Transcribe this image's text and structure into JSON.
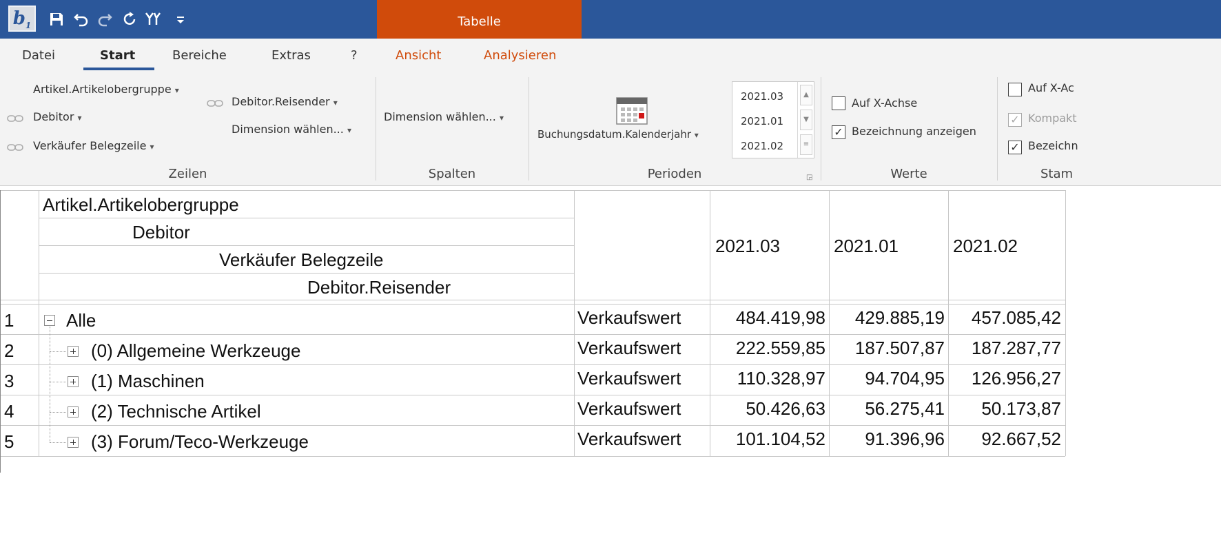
{
  "titlebar": {
    "logo_letter": "b",
    "logo_sub": "1",
    "context_tab": "Tabelle",
    "qa_icons": [
      "save-icon",
      "undo-icon",
      "redo-icon",
      "refresh-icon",
      "tools-icon",
      "customize-icon"
    ]
  },
  "tabs": {
    "datei": "Datei",
    "start": "Start",
    "bereiche": "Bereiche",
    "extras": "Extras",
    "help": "?",
    "ansicht": "Ansicht",
    "analysieren": "Analysieren"
  },
  "ribbon": {
    "zeilen": {
      "label": "Zeilen",
      "artikelobergruppe": "Artikel.Artikelobergruppe",
      "debitor": "Debitor",
      "verkaeufer": "Verkäufer Belegzeile",
      "reisender": "Debitor.Reisender",
      "dimension": "Dimension wählen..."
    },
    "spalten": {
      "label": "Spalten",
      "dimension": "Dimension wählen..."
    },
    "perioden": {
      "label": "Perioden",
      "field": "Buchungsdatum.Kalenderjahr",
      "values": [
        "2021.03",
        "2021.01",
        "2021.02"
      ]
    },
    "werte": {
      "label": "Werte",
      "x_achse": "Auf X-Achse",
      "bezeichnung": "Bezeichnung anzeigen"
    },
    "stamm": {
      "label": "Stam",
      "x_achse": "Auf X-Ac",
      "kompakt": "Kompakt",
      "bezeichnung": "Bezeichn"
    },
    "caret": "▾"
  },
  "grid": {
    "header_levels": [
      "Artikel.Artikelobergruppe",
      "Debitor",
      "Verkäufer Belegzeile",
      "Debitor.Reisender"
    ],
    "columns": [
      "2021.03",
      "2021.01",
      "2021.02"
    ],
    "rows": [
      {
        "num": "1",
        "label": "Alle",
        "measure": "Verkaufswert",
        "values": [
          "484.419,98",
          "429.885,19",
          "457.085,42"
        ]
      },
      {
        "num": "2",
        "label": "(0) Allgemeine Werkzeuge",
        "measure": "Verkaufswert",
        "values": [
          "222.559,85",
          "187.507,87",
          "187.287,77"
        ]
      },
      {
        "num": "3",
        "label": "(1) Maschinen",
        "measure": "Verkaufswert",
        "values": [
          "110.328,97",
          "94.704,95",
          "126.956,27"
        ]
      },
      {
        "num": "4",
        "label": "(2) Technische Artikel",
        "measure": "Verkaufswert",
        "values": [
          "50.426,63",
          "56.275,41",
          "50.173,87"
        ]
      },
      {
        "num": "5",
        "label": "(3) Forum/Teco-Werkzeuge",
        "measure": "Verkaufswert",
        "values": [
          "101.104,52",
          "91.396,96",
          "92.667,52"
        ]
      }
    ]
  }
}
